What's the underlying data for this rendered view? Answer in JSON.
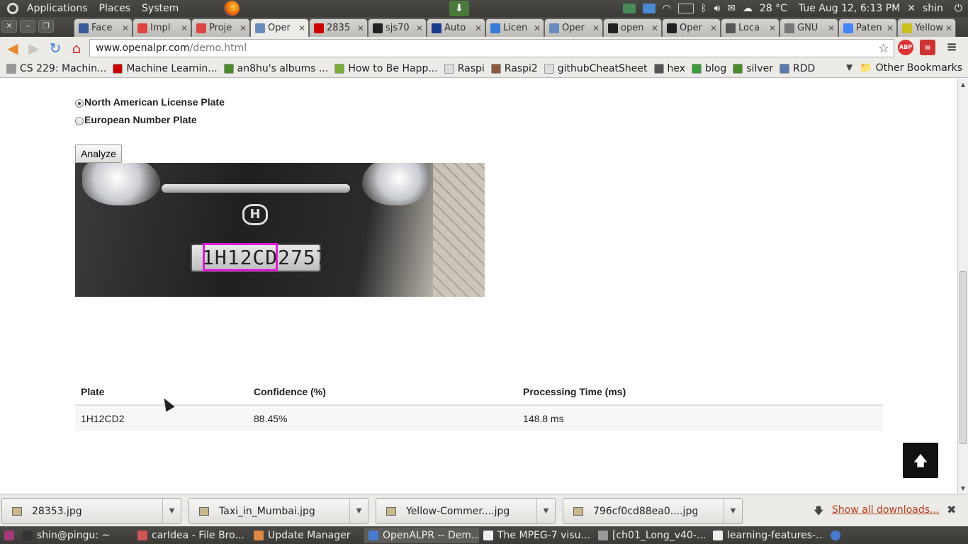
{
  "gnome_panel": {
    "menus": [
      "Applications",
      "Places",
      "System"
    ],
    "weather": "28 °C",
    "datetime": "Tue Aug 12,  6:13 PM",
    "user": "shin"
  },
  "tabs": [
    {
      "label": "Face",
      "favicon": "facebook",
      "color": "#3b5998"
    },
    {
      "label": "Impl",
      "favicon": "gmail",
      "color": "#d44"
    },
    {
      "label": "Proje",
      "favicon": "gmail",
      "color": "#d44"
    },
    {
      "label": "Oper",
      "favicon": "page",
      "color": "#6a8bc0",
      "active": true
    },
    {
      "label": "2835",
      "favicon": "ted",
      "color": "#c00"
    },
    {
      "label": "sjs70",
      "favicon": "github",
      "color": "#222"
    },
    {
      "label": "Auto",
      "favicon": "nec",
      "color": "#1a3a8c"
    },
    {
      "label": "Licen",
      "favicon": "k",
      "color": "#3a7bd5"
    },
    {
      "label": "Oper",
      "favicon": "page",
      "color": "#6a8bc0"
    },
    {
      "label": "open",
      "favicon": "github",
      "color": "#222"
    },
    {
      "label": "Oper",
      "favicon": "github",
      "color": "#222"
    },
    {
      "label": "Loca",
      "favicon": "wikipedia",
      "color": "#555"
    },
    {
      "label": "GNU",
      "favicon": "gnu",
      "color": "#777"
    },
    {
      "label": "Paten",
      "favicon": "google",
      "color": "#4285f4"
    },
    {
      "label": "Yellow",
      "favicon": "yellow",
      "color": "#c9c020"
    }
  ],
  "url": {
    "host": "www.openalpr.com",
    "path": "/demo.html"
  },
  "bookmarks": [
    {
      "label": "CS 229: Machin...",
      "color": "#999"
    },
    {
      "label": "Machine Learnin...",
      "color": "#c00"
    },
    {
      "label": "an8hu's albums ...",
      "color": "#4a8a2a"
    },
    {
      "label": "How to Be Happ...",
      "color": "#7ab03a"
    },
    {
      "label": "Raspi",
      "color": "#ddd"
    },
    {
      "label": "Raspi2",
      "color": "#8a5a3a"
    },
    {
      "label": "githubCheatSheet",
      "color": "#ddd"
    },
    {
      "label": "hex",
      "color": "#555"
    },
    {
      "label": "blog",
      "color": "#3a9a3a"
    },
    {
      "label": "silver",
      "color": "#4a8a2a"
    },
    {
      "label": "RDD",
      "color": "#5a7ab0"
    }
  ],
  "other_bookmarks": "Other Bookmarks",
  "form": {
    "option_na": "North American License Plate",
    "option_eu": "European Number Plate",
    "analyze_label": "Analyze"
  },
  "image": {
    "plate_text": "1H12CD2757"
  },
  "results": {
    "headers": [
      "Plate",
      "Confidence (%)",
      "Processing Time (ms)"
    ],
    "rows": [
      [
        "1H12CD2",
        "88.45%",
        "148.8 ms"
      ]
    ]
  },
  "downloads": [
    "28353.jpg",
    "Taxi_in_Mumbai.jpg",
    "Yellow-Commer....jpg",
    "796cf0cd88ea0....jpg"
  ],
  "show_all": "Show all downloads...",
  "taskbar": [
    {
      "label": "shin@pingu: ~",
      "color": "#333"
    },
    {
      "label": "carIdea - File Bro...",
      "color": "#c55"
    },
    {
      "label": "Update Manager",
      "color": "#d84"
    },
    {
      "label": "OpenALPR -- Dem...",
      "color": "#4a7ad0",
      "active": true
    },
    {
      "label": "The MPEG-7 visu...",
      "color": "#eee"
    },
    {
      "label": "[ch01_Long_v40-...",
      "color": "#999"
    },
    {
      "label": "learning-features-...",
      "color": "#eee"
    }
  ]
}
